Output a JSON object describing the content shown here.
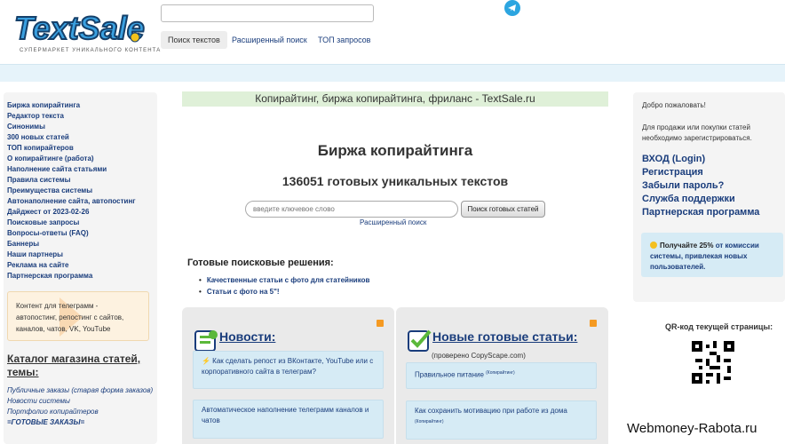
{
  "header": {
    "logo_text": "TextSale",
    "tagline": "СУПЕРМАРКЕТ УНИКАЛЬНОГО КОНТЕНТА",
    "search_value": "",
    "tabs": [
      {
        "label": "Поиск текстов",
        "active": true
      },
      {
        "label": "Расширенный поиск",
        "active": false
      },
      {
        "label": "ТОП запросов",
        "active": false
      }
    ],
    "telegram_icon": "telegram-icon"
  },
  "left_nav": [
    "Биржа копирайтинга",
    "Редактор текста",
    "Синонимы",
    "300 новых статей",
    "ТОП копирайтеров",
    "О копирайтинге (работа)",
    "Наполнение сайта статьями",
    "Правила системы",
    "Преимущества системы",
    "Автонаполнение сайта, автопостинг",
    "Дайджест от 2023-02-26",
    "Поисковые запросы",
    "Вопросы-ответы (FAQ)",
    "Баннеры",
    "Наши партнеры",
    "Реклама на сайте",
    "Партнерская программа"
  ],
  "telegram_promo": "Контент для телеграмм - автопостинг, репостинг с сайтов, каналов, чатов, VK, YouTube",
  "catalog": {
    "title": "Каталог магазина статей, темы:",
    "items": [
      "Публичные заказы (старая форма заказов)",
      "Новости системы",
      "Портфолио копирайтеров",
      "=ГОТОВЫЕ ЗАКАЗЫ="
    ]
  },
  "main": {
    "banner": "Копирайтинг, биржа копирайтинга, фриланс - TextSale.ru",
    "title": "Биржа копирайтинга",
    "count": "136051 готовых уникальных текстов",
    "keyword_placeholder": "введите ключевое слово",
    "search_button": "Поиск готовых статей",
    "advanced_link": "Расширенный поиск",
    "ready_title": "Готовые поисковые решения:",
    "ready_items": [
      "Качественные статьи с фото для статейников",
      "Статьи с фото на 5\"!"
    ]
  },
  "news": {
    "title": "Новости:",
    "items": [
      "⚡ Как сделать репост из ВКонтакте, YouTube или с корпоративного сайта в телеграм?",
      "Автоматическое наполнение телеграмм каналов и чатов"
    ]
  },
  "articles": {
    "title": "Новые готовые статьи:",
    "checked": "(проверено CopyScape.com)",
    "items": [
      {
        "text": "Правильное питание",
        "tag": "(Копирайтинг)"
      },
      {
        "text": "Как сохранить мотивацию при работе из дома",
        "tag": "(Копирайтинг)"
      }
    ]
  },
  "right": {
    "welcome": "Добро пожаловать!",
    "reg_note": "Для продажи или покупки статей необходимо зарегистрироваться.",
    "links": [
      "ВХОД (Login)",
      "Регистрация",
      "Забыли пароль?",
      "Служба поддержки",
      "Партнерская программа"
    ],
    "promo_bold": "Получайте 25%",
    "promo_rest": " от комиссии системы, привлекая новых пользователей.",
    "qr_label": "QR-код текущей страницы:"
  },
  "watermark": "Webmoney-Rabota.ru",
  "colors": {
    "link": "#1a3d7c",
    "band": "#e6f3fa",
    "banner": "#dff0d8",
    "card": "#d6ebf5",
    "rss": "#f59a22"
  }
}
